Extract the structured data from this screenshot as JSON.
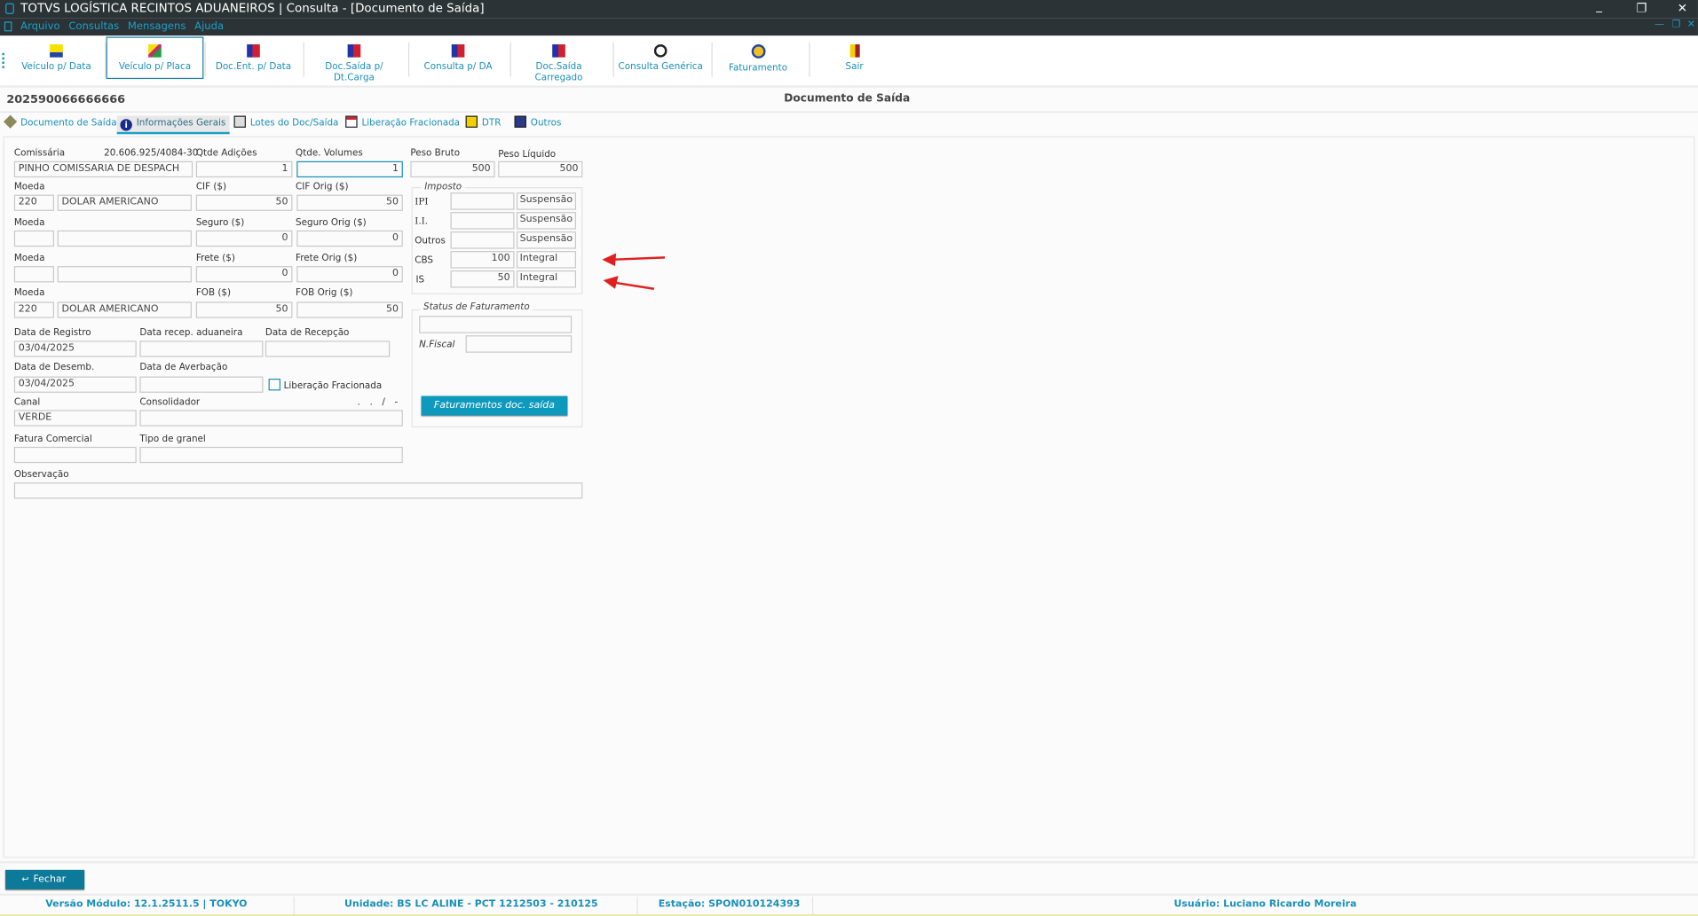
{
  "window": {
    "title": "TOTVS LOGÍSTICA RECINTOS ADUANEIROS | Consulta - [Documento de Saída]"
  },
  "menu": [
    "Arquivo",
    "Consultas",
    "Mensagens",
    "Ajuda"
  ],
  "toolbar": [
    {
      "label": "Veículo p/ Data",
      "icon": "vehicle-icon"
    },
    {
      "label": "Veículo p/ Placa",
      "icon": "vehicle-plate-icon",
      "selected": true
    },
    {
      "label": "Doc.Ent. p/ Data",
      "icon": "document-icon"
    },
    {
      "label": "Doc.Saída p/ Dt.Carga",
      "icon": "document-icon"
    },
    {
      "label": "Consulta p/ DA",
      "icon": "document-check-icon"
    },
    {
      "label": "Doc.Saída Carregado",
      "icon": "document-icon"
    },
    {
      "label": "Consulta Genérica",
      "icon": "magnifier-icon"
    },
    {
      "label": "Faturamento",
      "icon": "money-icon"
    },
    {
      "label": "Sair",
      "icon": "exit-door-icon"
    }
  ],
  "header": {
    "doc_number": "202590066666666",
    "title": "Documento de Saída"
  },
  "tabs": [
    "Documento de Saída",
    "Informações Gerais",
    "Lotes do Doc/Saída",
    "Liberação Fracionada",
    "DTR",
    "Outros"
  ],
  "form": {
    "comissaria": {
      "label": "Comissária",
      "cnpj": "20.606.925/4084-30",
      "value": "PINHO COMISSARIA DE DESPACH"
    },
    "qtde_adicoes": {
      "label": "Qtde Adições",
      "value": "1"
    },
    "qtde_volumes": {
      "label": "Qtde. Volumes",
      "value": "1"
    },
    "peso_bruto": {
      "label": "Peso Bruto",
      "value": "500"
    },
    "peso_liquido": {
      "label": "Peso Líquido",
      "value": "500"
    },
    "moeda_label": "Moeda",
    "cif": {
      "moeda_code": "220",
      "moeda_name": "DOLAR AMERICANO",
      "label": "CIF ($)",
      "value": "50",
      "orig_label": "CIF Orig ($)",
      "orig_value": "50"
    },
    "seguro": {
      "moeda_code": "",
      "moeda_name": "",
      "label": "Seguro ($)",
      "value": "0",
      "orig_label": "Seguro Orig ($)",
      "orig_value": "0"
    },
    "frete": {
      "moeda_code": "",
      "moeda_name": "",
      "label": "Frete ($)",
      "value": "0",
      "orig_label": "Frete Orig ($)",
      "orig_value": "0"
    },
    "fob": {
      "moeda_code": "220",
      "moeda_name": "DOLAR AMERICANO",
      "label": "FOB ($)",
      "value": "50",
      "orig_label": "FOB Orig ($)",
      "orig_value": "50"
    },
    "data_registro": {
      "label": "Data de Registro",
      "value": "03/04/2025"
    },
    "data_recep_aduaneira": {
      "label": "Data recep. aduaneira",
      "value": ""
    },
    "data_recepcao": {
      "label": "Data de Recepção",
      "value": ""
    },
    "data_desemb": {
      "label": "Data de Desemb.",
      "value": "03/04/2025"
    },
    "data_averbacao": {
      "label": "Data de Averbação",
      "value": ""
    },
    "liberacao_fracionada": {
      "label": "Liberação Fracionada",
      "checked": false
    },
    "canal": {
      "label": "Canal",
      "value": "VERDE"
    },
    "consolidador": {
      "label": "Consolidador",
      "mask": ". . / -",
      "value": ""
    },
    "fatura_comercial": {
      "label": "Fatura Comercial",
      "value": ""
    },
    "tipo_granel": {
      "label": "Tipo de granel",
      "value": ""
    },
    "observacao": {
      "label": "Observação",
      "value": ""
    }
  },
  "imposto": {
    "legend": "Imposto",
    "rows": [
      {
        "label": "IPI",
        "value": "",
        "regime": "Suspensão"
      },
      {
        "label": "I.I.",
        "value": "",
        "regime": "Suspensão"
      },
      {
        "label": "Outros",
        "value": "",
        "regime": "Suspensão"
      },
      {
        "label": "CBS",
        "value": "100",
        "regime": "Integral"
      },
      {
        "label": "IS",
        "value": "50",
        "regime": "Integral"
      }
    ]
  },
  "faturamento": {
    "legend": "Status de Faturamento",
    "status": "",
    "nfiscal_label": "N.Fiscal",
    "nfiscal": "",
    "button": "Faturamentos doc. saída"
  },
  "footer": {
    "close": "Fechar"
  },
  "statusbar": {
    "versao": "Versão Módulo:  12.1.2511.5  |  TOKYO",
    "unidade": "Unidade: BS LC ALINE - PCT 1212503 - 210125",
    "estacao": "Estação: SPON010124393",
    "usuario": "Usuário: Luciano Ricardo Moreira"
  },
  "colors": {
    "accent": "#1a8fb8",
    "titlebar": "#2b3336",
    "button": "#0e9abd",
    "annotation_arrow": "#e02020"
  }
}
